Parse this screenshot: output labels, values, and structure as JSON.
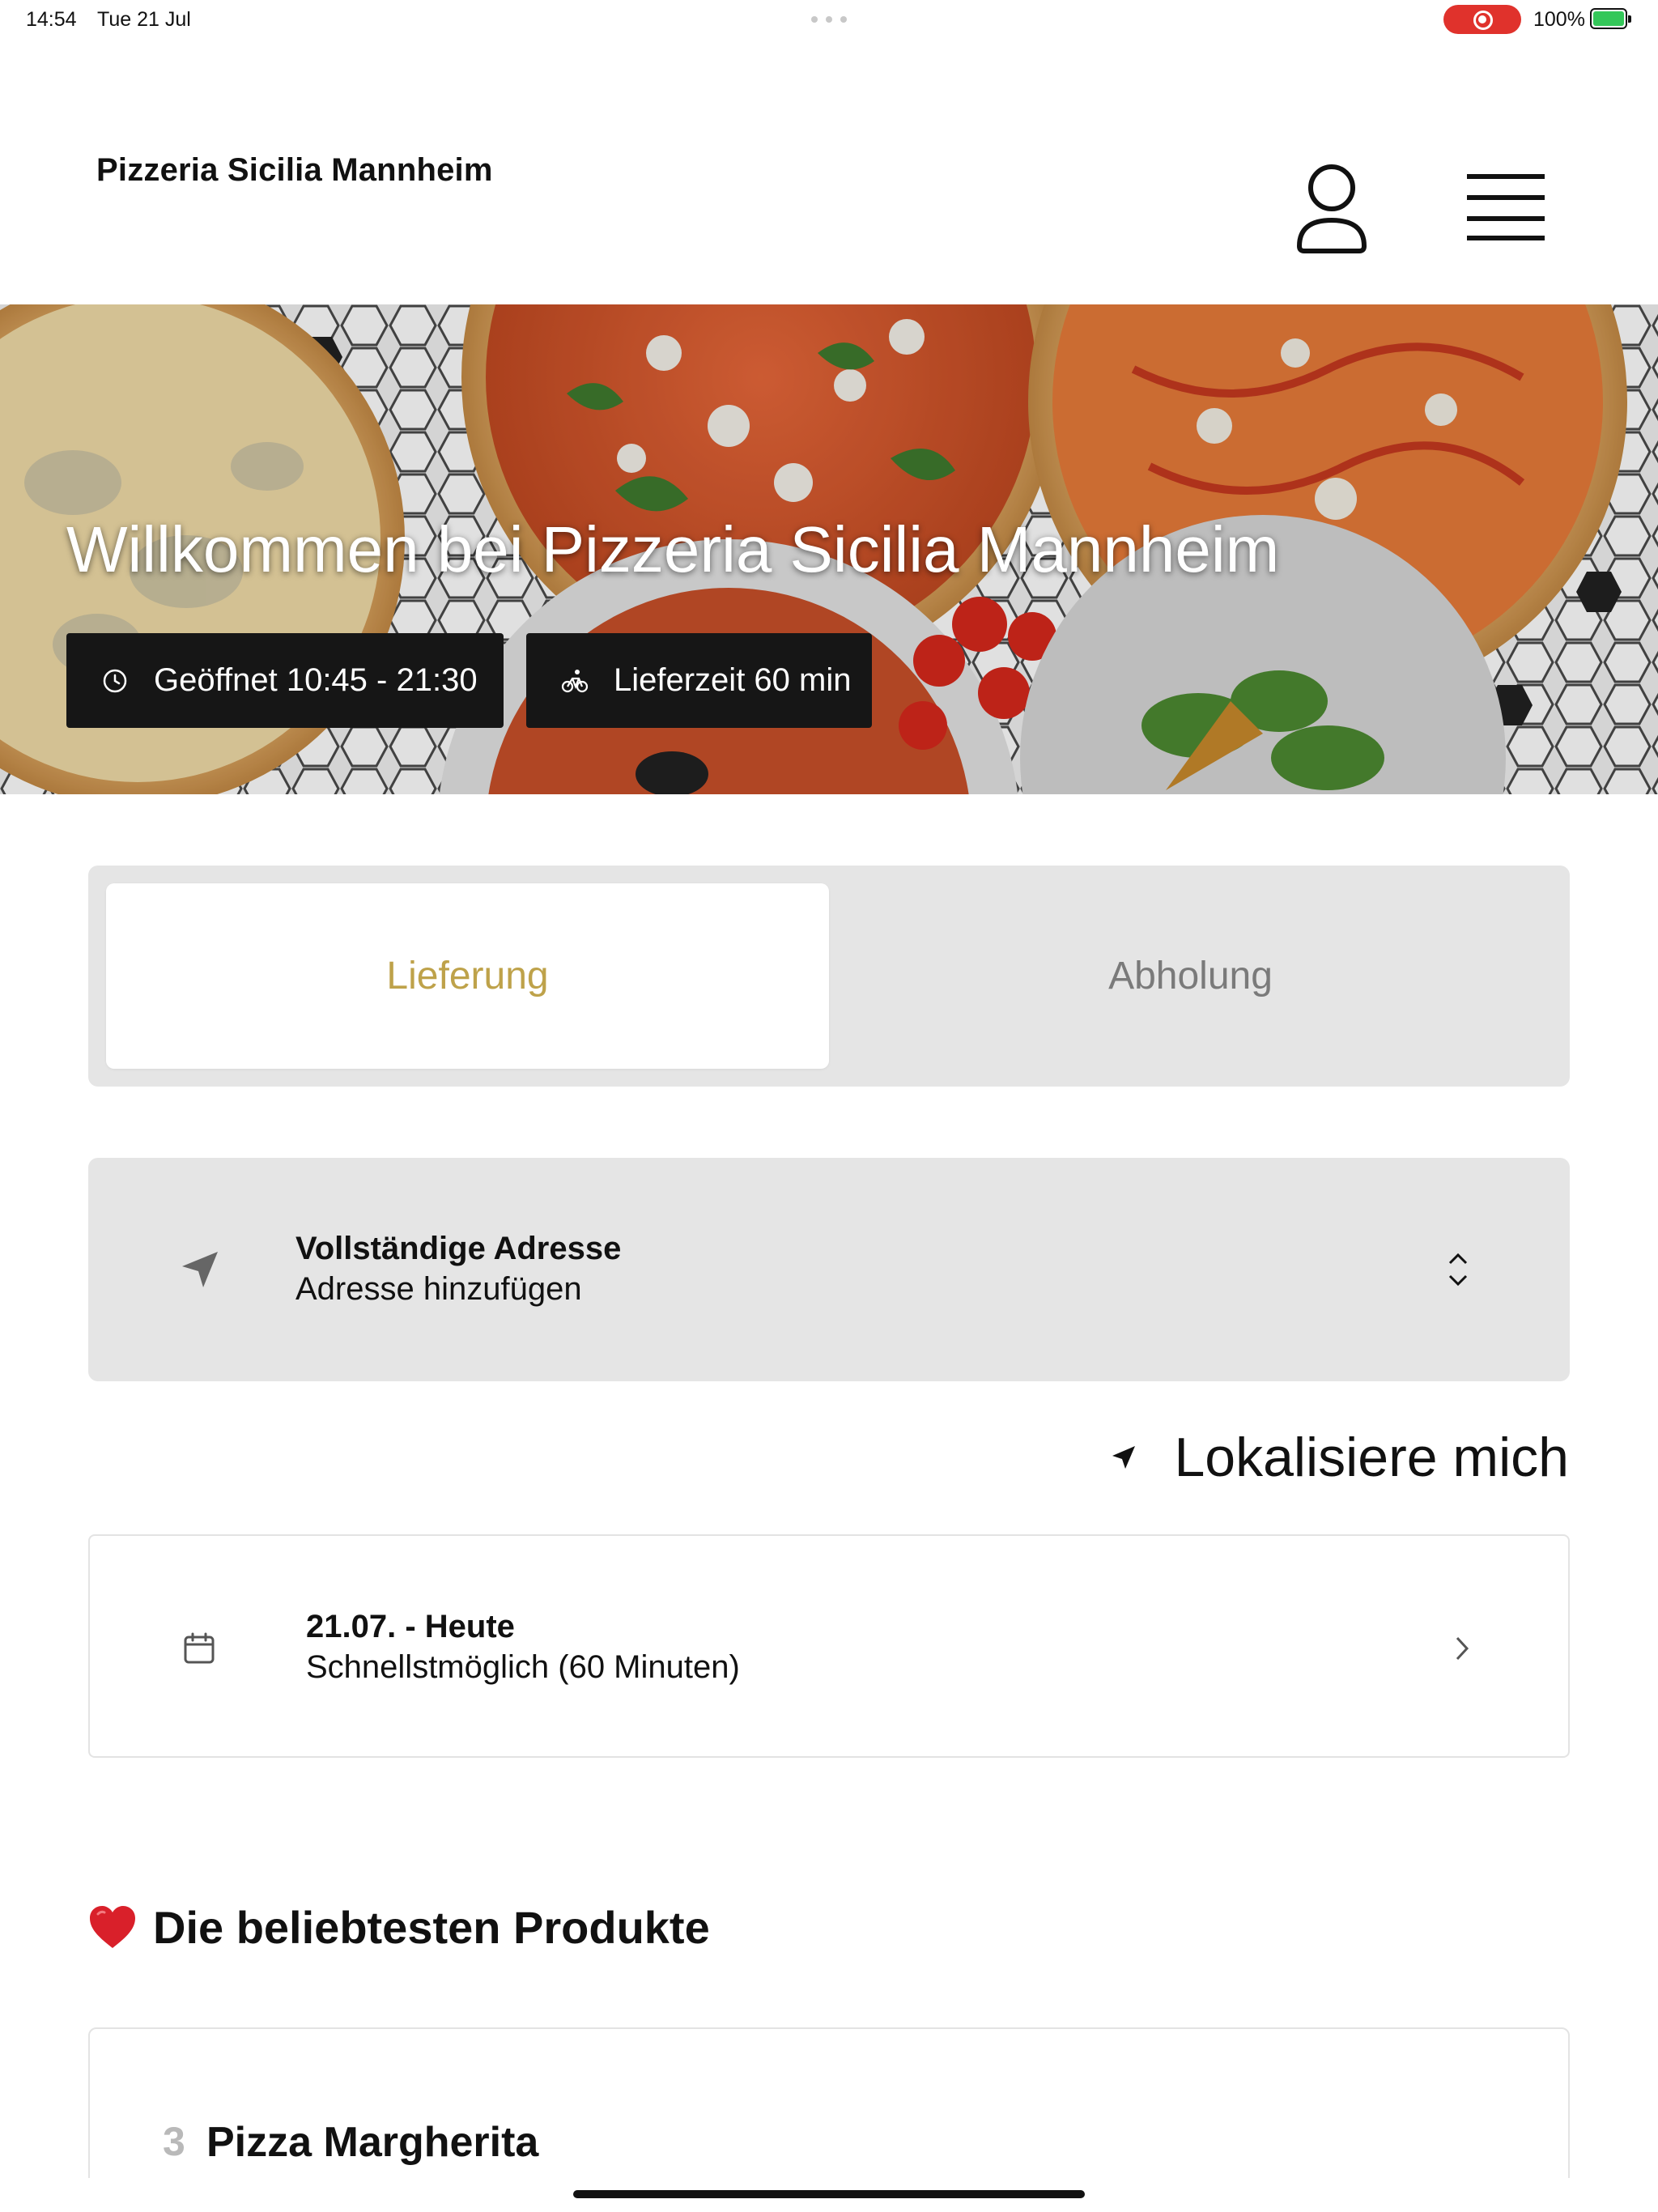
{
  "status_bar": {
    "time": "14:54",
    "date": "Tue 21 Jul",
    "battery_percent": "100%",
    "recording_color": "#e0322c",
    "battery_color": "#34c759"
  },
  "header": {
    "brand": "Pizzeria Sicilia Mannheim",
    "user_icon": "user-icon",
    "menu_icon": "hamburger-menu-icon"
  },
  "hero": {
    "title": "Willkommen bei Pizzeria Sicilia Mannheim",
    "opening_hours": "Geöffnet 10:45 - 21:30",
    "delivery_time": "Lieferzeit 60 min",
    "clock_icon": "clock-icon",
    "bike_icon": "bicycle-icon"
  },
  "order_mode": {
    "tabs": [
      {
        "label": "Lieferung",
        "active": true
      },
      {
        "label": "Abholung",
        "active": false
      }
    ],
    "accent_color": "#bea24a"
  },
  "address": {
    "label": "Vollständige Adresse",
    "value": "Adresse hinzufügen",
    "icon": "navigation-arrow-icon",
    "chevron_icon": "chevron-up-down-icon"
  },
  "locate": {
    "label": "Lokalisiere mich",
    "icon": "location-arrow-icon"
  },
  "schedule": {
    "date": "21.07. - Heute",
    "time": "Schnellstmöglich (60 Minuten)",
    "icon": "calendar-icon",
    "arrow_icon": "chevron-right-icon"
  },
  "popular": {
    "title": "Die beliebtesten Produkte",
    "icon": "heart-icon",
    "products": [
      {
        "rank": "3",
        "name": "Pizza Margherita"
      }
    ]
  }
}
